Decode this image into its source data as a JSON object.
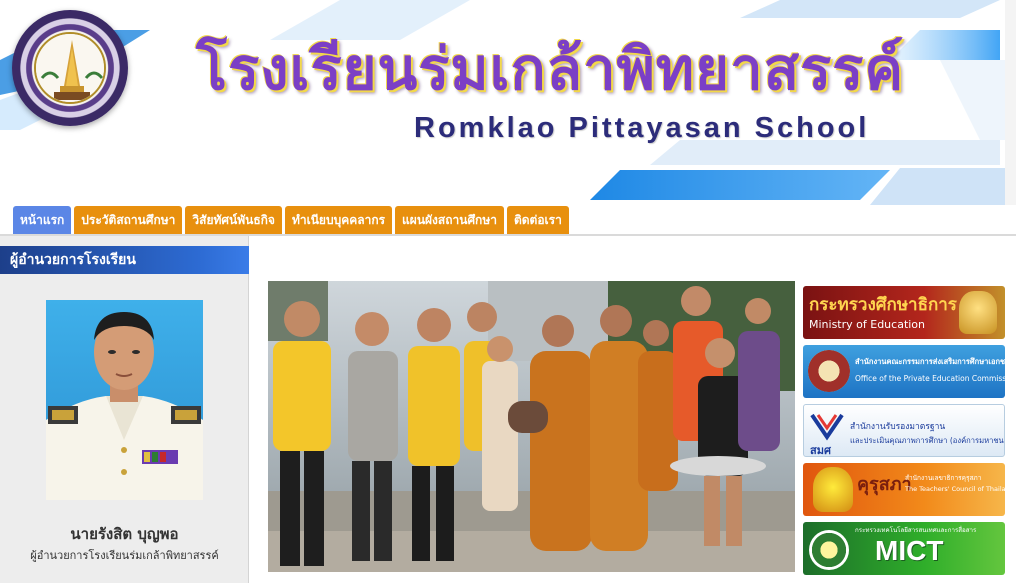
{
  "header": {
    "title_th": "โรงเรียนร่มเกล้าพิทยาสรรค์",
    "title_en": "Romklao Pittayasan School",
    "logo_text": "โรงเรียนร่มเกล้าพิทยาสรรค์"
  },
  "nav": {
    "tabs": [
      {
        "label": "หน้าแรก",
        "active": true
      },
      {
        "label": "ประวัติสถานศึกษา"
      },
      {
        "label": "วิสัยทัศน์พันธกิจ"
      },
      {
        "label": "ทำเนียบบุคคลากร"
      },
      {
        "label": "แผนผังสถานศึกษา"
      },
      {
        "label": "ติดต่อเรา"
      }
    ]
  },
  "director": {
    "section_title": "ผู้อำนวยการโรงเรียน",
    "name": "นายรังสิต  บุญพอ",
    "position": "ผู้อำนวยการโรงเรียนร่มเกล้าพิทยาสรรค์"
  },
  "banners": [
    {
      "line1": "กระทรวงศึกษาธิการ",
      "line2": "Ministry of Education"
    },
    {
      "line1": "สำนักงานคณะกรรมการส่งเสริมการศึกษาเอกชน",
      "line2": "Office of the Private Education Commission"
    },
    {
      "line1": "สำนักงานรับรองมาตรฐาน",
      "line2": "และประเมินคุณภาพการศึกษา (องค์การมหาชน)",
      "mark": "สมศ"
    },
    {
      "line1": "คุรุสภา",
      "line2": "สำนักงานเลขาธิการคุรุสภา",
      "line3": "The Teachers' Council of Thailand"
    },
    {
      "line1": "MICT",
      "line2": "กระทรวงเทคโนโลยีสารสนเทศและการสื่อสาร"
    }
  ],
  "colors": {
    "nav_tab": "#e8900e",
    "nav_active": "#5b86e6",
    "section_header": "#2d6bd3",
    "title_purple": "#7b3fc6"
  }
}
